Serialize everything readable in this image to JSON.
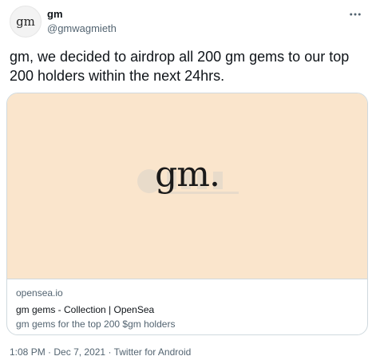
{
  "author": {
    "avatar_text": "gm",
    "display_name": "gm",
    "handle": "@gmwagmieth"
  },
  "more_icon": "ellipsis-icon",
  "tweet": {
    "text": "gm, we decided to airdrop all 200 gm gems to our top 200 holders within the next 24hrs."
  },
  "card": {
    "image_text": "gm.",
    "image_bg": "#fae5cc",
    "domain": "opensea.io",
    "title": "gm gems - Collection | OpenSea",
    "description": "gm gems for the top 200 $gm holders"
  },
  "footer": {
    "time": "1:08 PM",
    "date": "Dec 7, 2021",
    "source": "Twitter for Android",
    "separator": "·"
  },
  "colors": {
    "text_primary": "#0f1419",
    "text_secondary": "#536471",
    "border": "#cfd9de"
  }
}
